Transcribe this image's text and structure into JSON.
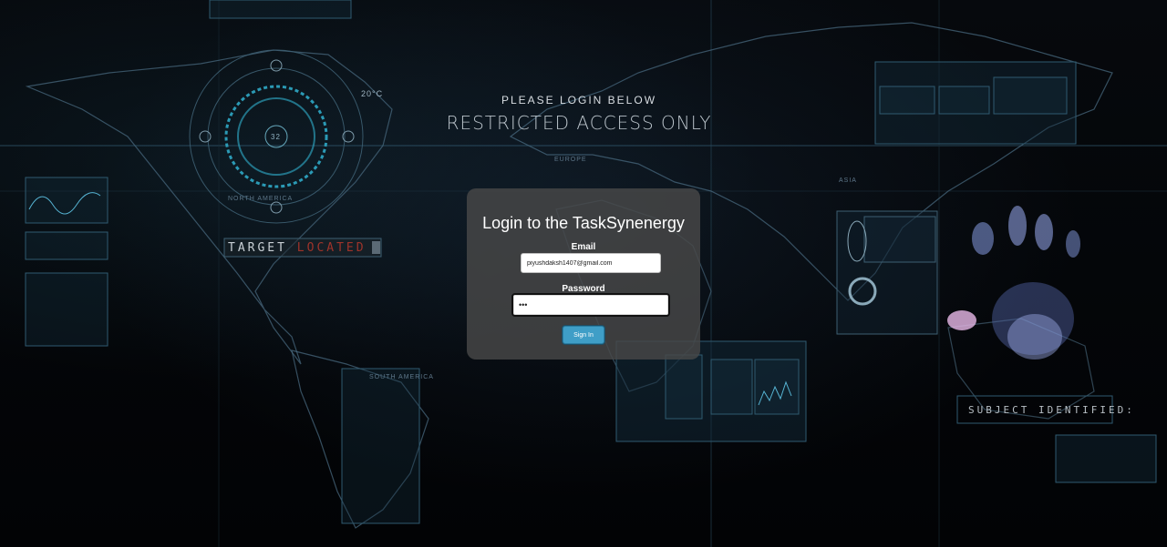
{
  "background": {
    "header_line1": "PLEASE LOGIN BELOW",
    "header_line2": "RESTRICTED ACCESS ONLY",
    "target_label": "TARGET",
    "target_status": "LOCATED",
    "subject_text": "SUBJECT IDENTIFIED:",
    "map_labels": {
      "europe": "EUROPE",
      "asia": "ASIA",
      "north_america": "NORTH AMERICA",
      "south_america": "SOUTH AMERICA",
      "hud_temp": "20°C",
      "hud_number": "32"
    }
  },
  "login": {
    "title": "Login to the TaskSynenergy",
    "email_label": "Email",
    "email_value": "piyushdaksh1407@gmail.com",
    "password_label": "Password",
    "password_value": "•••",
    "signin_label": "Sign In"
  },
  "colors": {
    "panel": "#484848",
    "button": "#3f9ec7",
    "located": "#c0392b",
    "hud_cyan": "#2fa9c6"
  }
}
